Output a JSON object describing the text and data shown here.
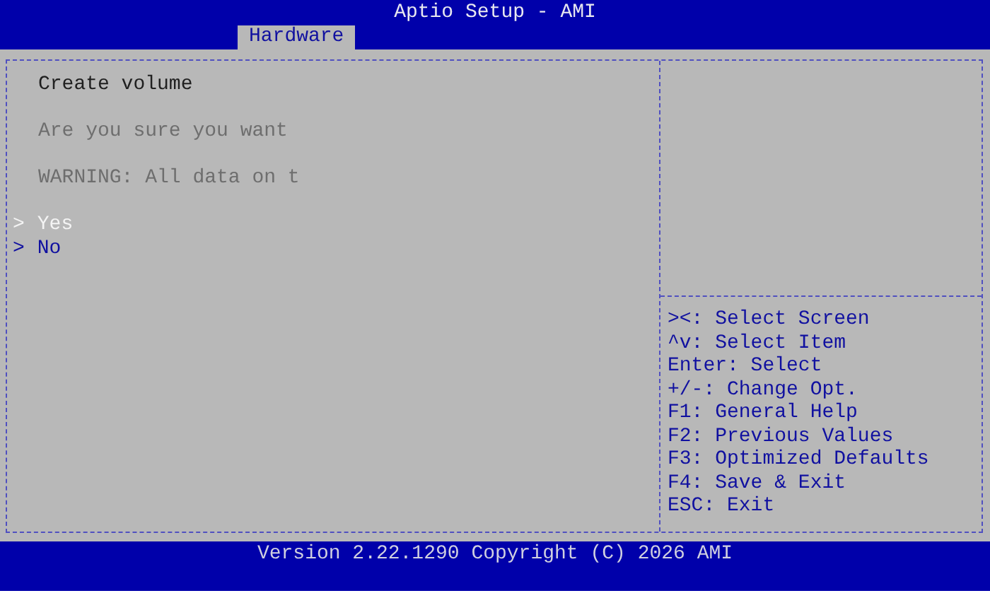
{
  "window": {
    "title": "Aptio Setup - AMI"
  },
  "tabs": [
    {
      "label": "Hardware",
      "selected": true
    }
  ],
  "dialog": {
    "title": "Create volume",
    "lines": [
      {
        "text": "Are you sure you want",
        "disabled": true
      },
      {
        "text": "WARNING: All data on t",
        "disabled": true
      }
    ],
    "options": [
      {
        "marker": ">",
        "label": "Yes",
        "selected": true
      },
      {
        "marker": ">",
        "label": "No",
        "selected": false
      }
    ]
  },
  "help": [
    "><: Select Screen",
    "^v: Select Item",
    "Enter: Select",
    "+/-: Change Opt.",
    "F1: General Help",
    "F2: Previous Values",
    "F3: Optimized Defaults",
    "F4: Save & Exit",
    "ESC: Exit"
  ],
  "status_bar": {
    "text": "Version 2.22.1290 Copyright (C) 2026 AMI"
  }
}
